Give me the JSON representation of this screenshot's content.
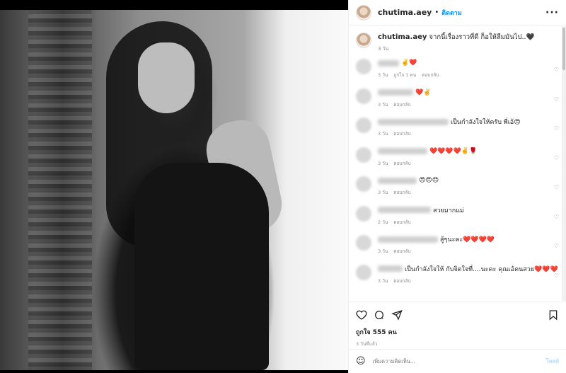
{
  "header": {
    "username": "chutima.aey",
    "separator": "•",
    "follow_label": "ติดตาม",
    "more_label": "···"
  },
  "caption": {
    "username": "chutima.aey",
    "text": "จากนี้เรื่องราวที่ดี ก็อให้ลืมมันไป..🖤",
    "time": "3 วัน"
  },
  "comments": [
    {
      "text": "✌️❤️",
      "time": "3 วัน",
      "likes": "ถูกใจ 1 คน",
      "reply": "ตอบกลับ",
      "w": 30
    },
    {
      "text": "❤️✌️",
      "time": "3 วัน",
      "likes": "",
      "reply": "ตอบกลับ",
      "w": 50
    },
    {
      "text": "เป็นกำลังใจให้ครับ พี่เอ้😍",
      "time": "3 วัน",
      "likes": "",
      "reply": "ตอบกลับ",
      "w": 100
    },
    {
      "text": "❤️❤️❤️❤️✌️🌹",
      "time": "3 วัน",
      "likes": "",
      "reply": "ตอบกลับ",
      "w": 70
    },
    {
      "text": "😍😍😍",
      "time": "3 วัน",
      "likes": "",
      "reply": "ตอบกลับ",
      "w": 55
    },
    {
      "text": "สวยมากแม่",
      "time": "2 วัน",
      "likes": "",
      "reply": "ตอบกลับ",
      "w": 75
    },
    {
      "text": "สู้ๆนะคะ❤️❤️❤️❤️",
      "time": "3 วัน",
      "likes": "",
      "reply": "ตอบกลับ",
      "w": 85
    },
    {
      "text": "เป็นกำลังใจให้ กับจิตใจที่....นะคะ คุณเอ้คนสวย❤️❤️❤️",
      "time": "3 วัน",
      "likes": "",
      "reply": "ตอบกลับ",
      "w": 35
    }
  ],
  "actions": {
    "likes": "ถูกใจ 555 คน",
    "posted": "3 วันที่แล้ว"
  },
  "add_comment": {
    "placeholder": "เพิ่มความคิดเห็น...",
    "post_label": "โพสต์"
  }
}
